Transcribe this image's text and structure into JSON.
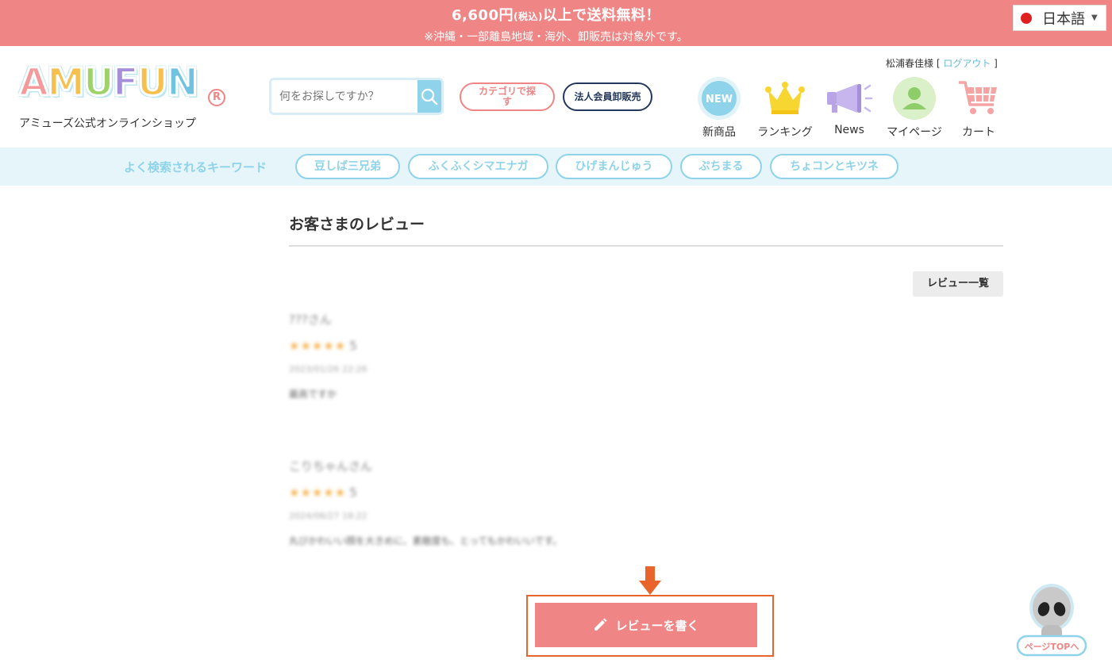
{
  "banner": {
    "line1_main": "6,600円",
    "line1_small": "(税込)",
    "line1_rest": "以上で送料無料！",
    "line2": "※沖縄・一部離島地域・海外、卸販売は対象外です。"
  },
  "language": {
    "selected": "日本語",
    "icon": "japan-flag-icon"
  },
  "header": {
    "logo_text": "AMUFUN",
    "logo_letters": [
      "A",
      "M",
      "U",
      "F",
      "U",
      "N"
    ],
    "registered_mark": "R",
    "tagline": "アミューズ公式オンラインショップ",
    "search_placeholder": "何をお探しですか？",
    "category_button": "カテゴリで探す",
    "business_button": "法人会員卸販売",
    "user_name": "松浦春佳様",
    "logout_link": "ログアウト",
    "nav": [
      {
        "label": "新商品",
        "icon": "new-badge-icon",
        "badge_text": "NEW"
      },
      {
        "label": "ランキング",
        "icon": "crown-icon"
      },
      {
        "label": "News",
        "icon": "megaphone-icon"
      },
      {
        "label": "マイページ",
        "icon": "user-icon"
      },
      {
        "label": "カート",
        "icon": "cart-icon"
      }
    ]
  },
  "keywords": {
    "title": "よく検索されるキーワード",
    "items": [
      "豆しば三兄弟",
      "ふくふくシマエナガ",
      "ひげまんじゅう",
      "ぷちまる",
      "ちょコンとキツネ"
    ]
  },
  "main": {
    "title": "お客さまのレビュー",
    "review_list_button": "レビュー一覧",
    "reviews": [
      {
        "name": "???さん",
        "stars": "★★★★★",
        "score": "5",
        "date": "2023/01/26 22:26",
        "body": "最高ですか"
      },
      {
        "name": "こりちゃんさん",
        "stars": "★★★★★",
        "score": "5",
        "date": "2024/06/27 18:22",
        "body": "丸びかわいい顔を大きめに、素敵度も、とってもかわいいです。"
      }
    ],
    "write_review_button": "レビューを書く"
  },
  "page_top": {
    "label": "ページTOPへ"
  },
  "colors": {
    "brand_pink": "#f08585",
    "brand_blue": "#8ed3ea",
    "navy": "#23385c",
    "highlight_orange": "#e8642a",
    "star": "#f6b048"
  }
}
